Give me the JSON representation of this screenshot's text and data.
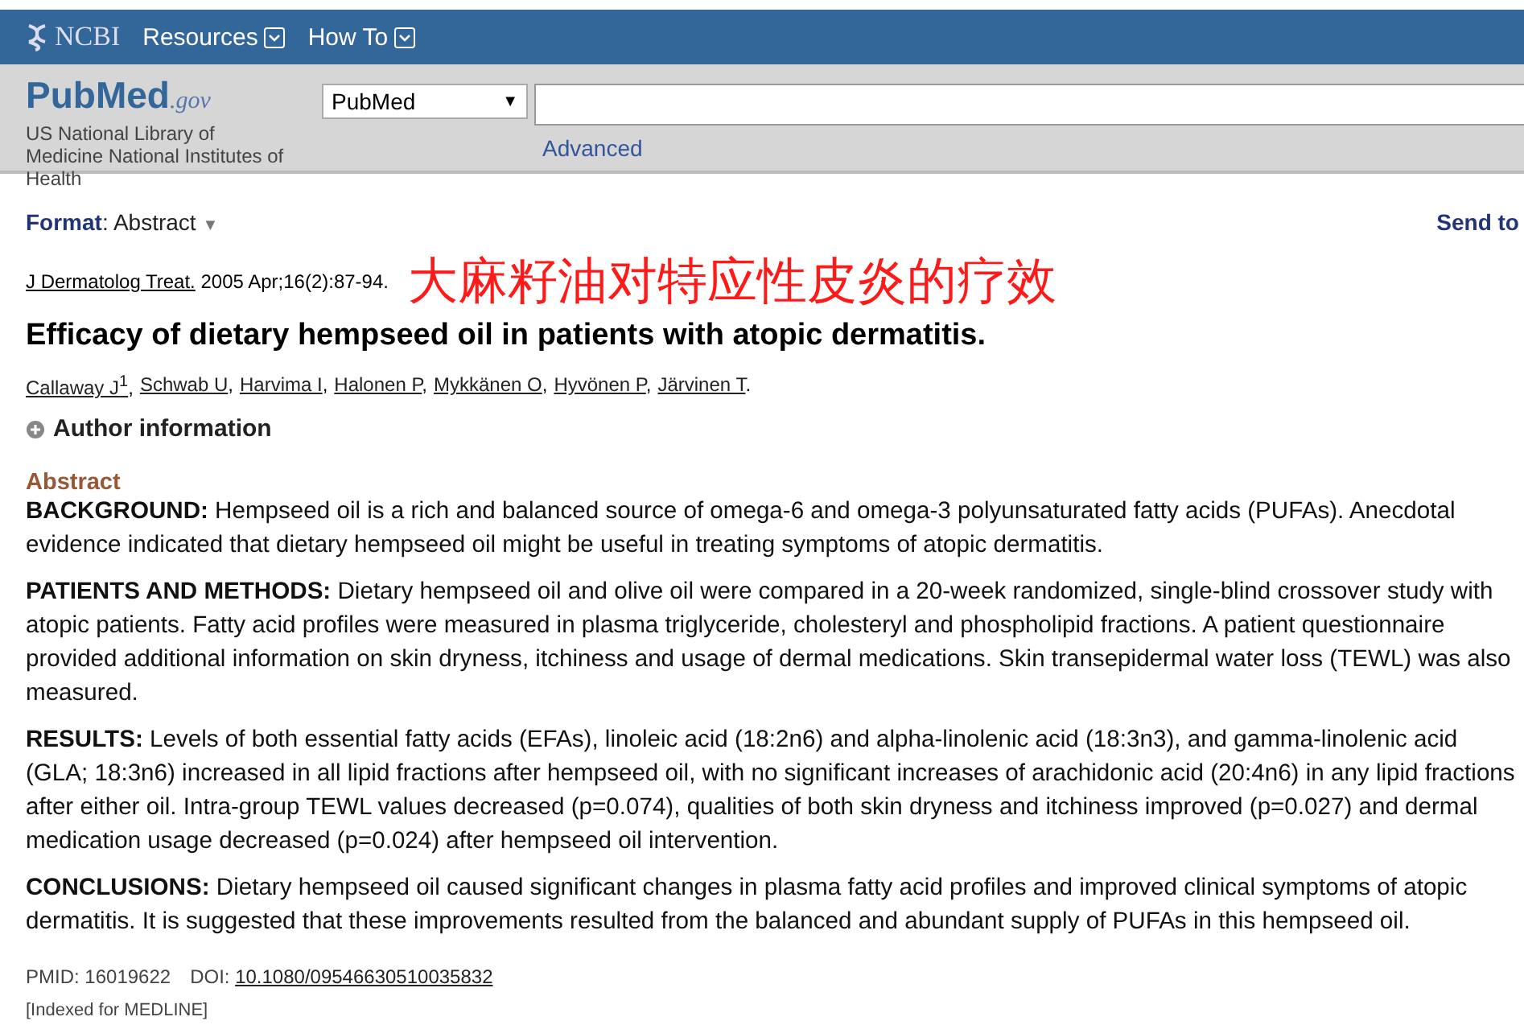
{
  "topbar": {
    "brand": "NCBI",
    "menus": [
      "Resources",
      "How To"
    ]
  },
  "masthead": {
    "logo_main": "PubMed",
    "logo_suffix": ".gov",
    "org": "US National Library of Medicine National Institutes of Health",
    "database": "PubMed",
    "database_caret": "▼",
    "advanced": "Advanced"
  },
  "format_label": "Format",
  "format_colon": ":",
  "format_value": "Abstract",
  "format_caret": "▼",
  "send_to": "Send to",
  "citation": {
    "journal": "J Dermatolog Treat.",
    "details": "2005 Apr;16(2):87-94."
  },
  "annotation": "大麻籽油对特应性皮炎的疗效",
  "title": "Efficacy of dietary hempseed oil in patients with atopic dermatitis.",
  "authors": [
    {
      "name": "Callaway J",
      "sup": "1",
      "sep": ","
    },
    {
      "name": "Schwab U",
      "sep": ","
    },
    {
      "name": "Harvima I",
      "sep": ","
    },
    {
      "name": "Halonen P",
      "sep": ","
    },
    {
      "name": "Mykkänen O",
      "sep": ","
    },
    {
      "name": "Hyvönen P",
      "sep": ","
    },
    {
      "name": "Järvinen T",
      "sep": "."
    }
  ],
  "author_info": {
    "label": "Author information",
    "expanded": false
  },
  "abstract_heading": "Abstract",
  "abstract": [
    "**BACKGROUND:** Hempseed oil is a rich and balanced source of omega-6 and omega-3 polyunsaturated fatty acids (PUFAs). Anecdotal evidence indicated that dietary hempseed oil might be useful in treating symptoms of atopic dermatitis.",
    "**PATIENTS AND METHODS:** Dietary hempseed oil and olive oil were compared in a 20-week randomized, single-blind crossover study with atopic patients. Fatty acid profiles were measured in plasma triglyceride, cholesteryl and phospholipid fractions. A patient questionnaire provided additional information on skin dryness, itchiness and usage of dermal medications. Skin transepidermal water loss (TEWL) was also measured.",
    "**RESULTS:** Levels of both essential fatty acids (EFAs), linoleic acid (18:2n6) and alpha-linolenic acid (18:3n3), and gamma-linolenic acid (GLA; 18:3n6) increased in all lipid fractions after hempseed oil, with no significant increases of arachidonic acid (20:4n6) in any lipid fractions after either oil. Intra-group TEWL values decreased (p=0.074), qualities of both skin dryness and itchiness improved (p=0.027) and dermal medication usage decreased (p=0.024) after hempseed oil intervention.",
    "**CONCLUSIONS:** Dietary hempseed oil caused significant changes in plasma fatty acid profiles and improved clinical symptoms of atopic dermatitis. It is suggested that these improvements resulted from the balanced and abundant supply of PUFAs in this hempseed oil."
  ],
  "ids": {
    "pmid": "PMID: 16019622",
    "doi_label": "DOI:",
    "doi": "10.1080/09546630510035832"
  },
  "indexed": "[Indexed for MEDLINE]"
}
